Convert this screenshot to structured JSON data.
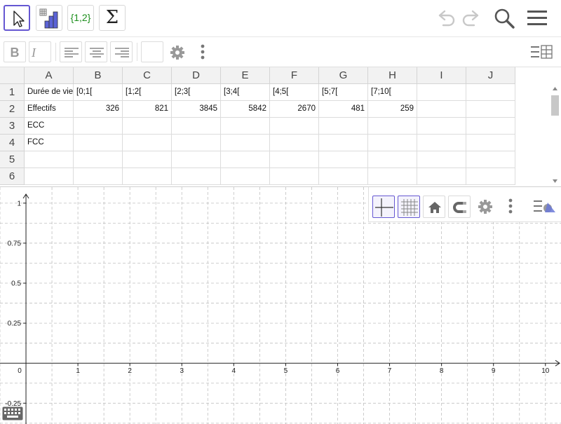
{
  "toolbar": {
    "tools": [
      {
        "name": "move-tool",
        "icon": "cursor-arrow-icon",
        "active": true
      },
      {
        "name": "two-variable-regression-tool",
        "icon": "histogram-icon",
        "active": false
      },
      {
        "name": "list-tool",
        "icon": "list-braces-icon",
        "label": "{1,2}",
        "active": false
      },
      {
        "name": "sum-tool",
        "icon": "sigma-icon",
        "label": "Σ",
        "active": false
      }
    ],
    "right_icons": [
      "undo-icon",
      "redo-icon",
      "search-icon",
      "menu-icon"
    ]
  },
  "stylebar": {
    "bold_label": "B",
    "italic_label": "I",
    "align_icons": [
      "align-left-icon",
      "align-center-icon",
      "align-right-icon"
    ],
    "extra_icons": [
      "background-color-icon",
      "gear-icon",
      "more-vert-icon",
      "spreadsheet-view-icon"
    ]
  },
  "spreadsheet": {
    "columns": [
      "A",
      "B",
      "C",
      "D",
      "E",
      "F",
      "G",
      "H",
      "I",
      "J"
    ],
    "rows": [
      {
        "num": "1",
        "cells": [
          "Durée de vie",
          "[0;1[",
          "[1;2[",
          "[2;3[",
          "[3;4[",
          "[4;5[",
          "[5;7[",
          "[7;10[",
          "",
          ""
        ]
      },
      {
        "num": "2",
        "cells": [
          "Effectifs",
          "326",
          "821",
          "3845",
          "5842",
          "2670",
          "481",
          "259",
          "",
          ""
        ]
      },
      {
        "num": "3",
        "cells": [
          "ECC",
          "",
          "",
          "",
          "",
          "",
          "",
          "",
          "",
          ""
        ]
      },
      {
        "num": "4",
        "cells": [
          "FCC",
          "",
          "",
          "",
          "",
          "",
          "",
          "",
          "",
          ""
        ]
      },
      {
        "num": "5",
        "cells": [
          "",
          "",
          "",
          "",
          "",
          "",
          "",
          "",
          "",
          ""
        ]
      },
      {
        "num": "6",
        "cells": [
          "",
          "",
          "",
          "",
          "",
          "",
          "",
          "",
          "",
          ""
        ]
      }
    ]
  },
  "graphics": {
    "x_ticks": [
      "0",
      "1",
      "2",
      "3",
      "4",
      "5",
      "6",
      "7",
      "8",
      "9",
      "10"
    ],
    "y_ticks": [
      "1",
      "0.75",
      "0.5",
      "0.25",
      "-0.25"
    ],
    "x_range": [
      -0.5,
      10.3
    ],
    "y_range": [
      -0.38,
      1.1
    ],
    "grid": true,
    "stylebar_icons": [
      "axes-icon",
      "grid-icon",
      "home-icon",
      "magnet-snap-icon",
      "gear-icon",
      "more-vert-icon",
      "graphics-style-icon"
    ]
  },
  "colors": {
    "accent": "#6557d2",
    "grid": "#c0c0c0",
    "header": "#f2f2f2"
  },
  "keyboard_icon": "keyboard-icon"
}
